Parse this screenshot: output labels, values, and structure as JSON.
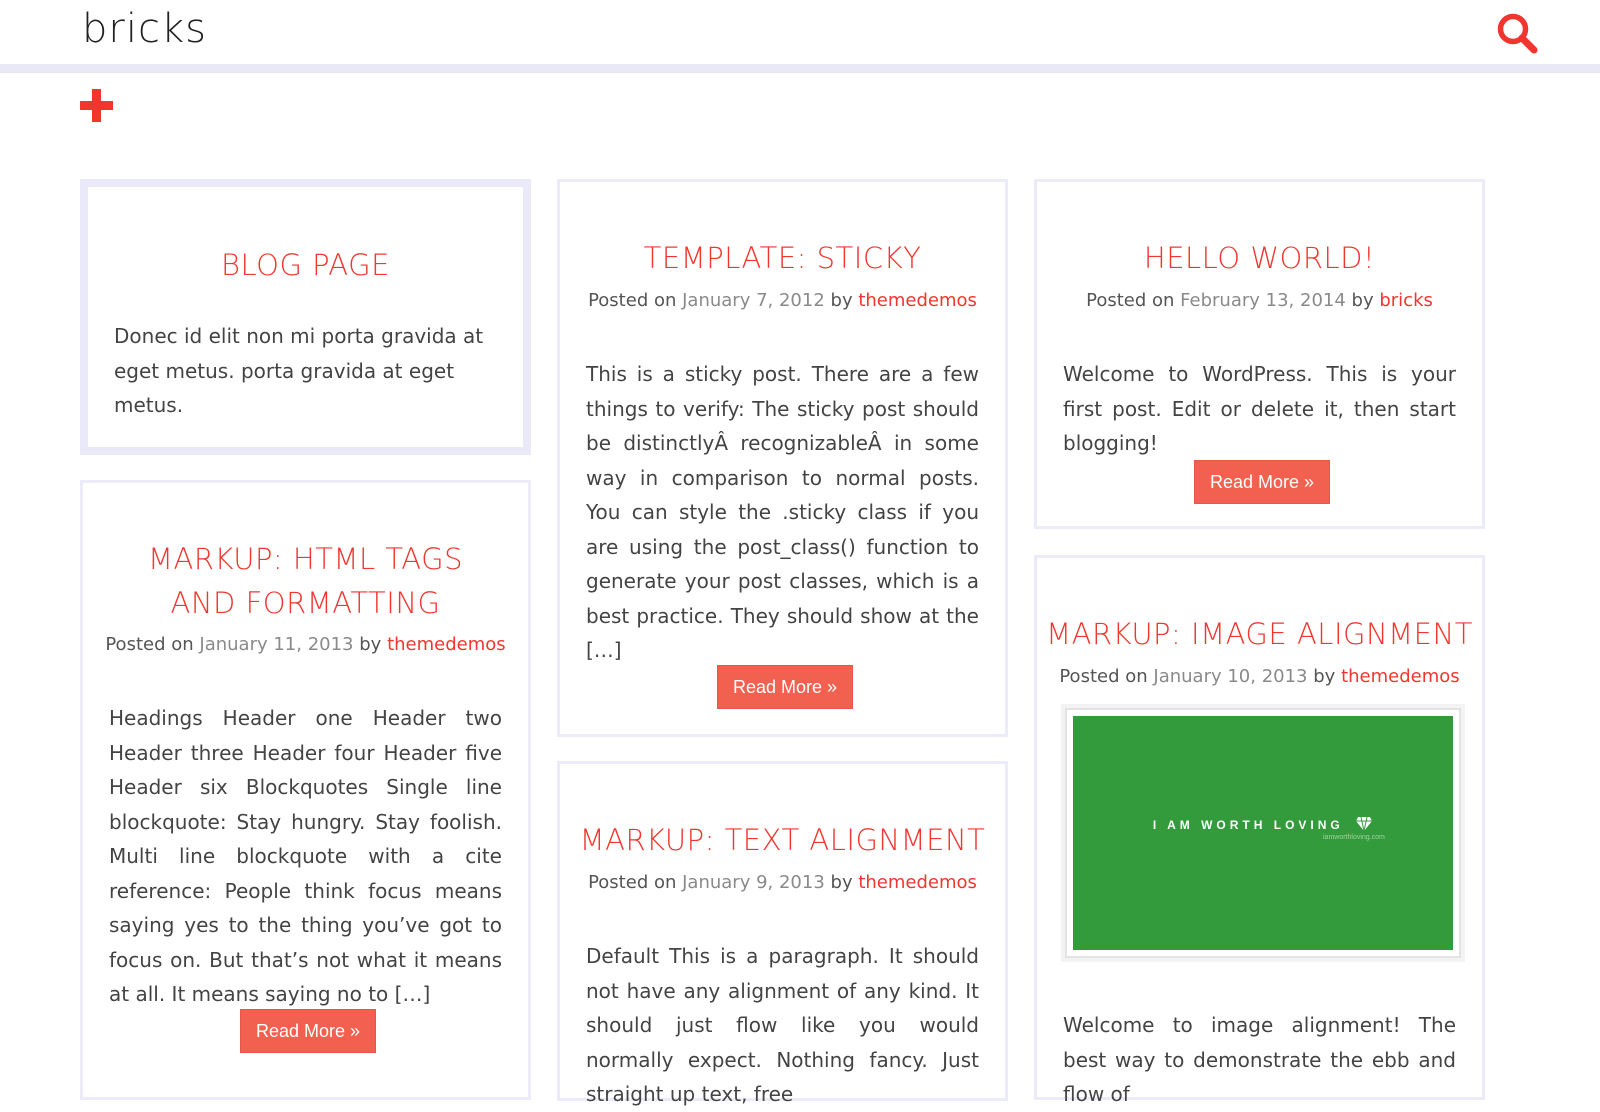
{
  "site": {
    "title": "bricks",
    "accent_color": "#f0362f",
    "button_color": "#f2614f",
    "icons": {
      "search": "search-icon",
      "menu": "plus-icon"
    }
  },
  "posts": [
    {
      "title": "BLOG PAGE",
      "excerpt": "Donec id elit non mi porta gravida at eget metus. porta gravida at eget metus."
    },
    {
      "title": "TEMPLATE: STICKY",
      "meta_prefix": "Posted on",
      "date": "January 7, 2012",
      "meta_by": "by",
      "author": "themedemos",
      "excerpt": "This is a sticky post. There are a few things to verify: The sticky post should be distinctlyÂ recognizableÂ in some way in comparison to normal posts. You can style the .sticky class if you are using the post_class() function to generate your post classes, which is a best practice. They should show at the […]",
      "read_more": "Read More »"
    },
    {
      "title": "HELLO WORLD!",
      "meta_prefix": "Posted on",
      "date": "February 13, 2014",
      "meta_by": "by",
      "author": "bricks",
      "excerpt": "Welcome to WordPress. This is your first post. Edit or delete it, then start blogging!",
      "read_more": "Read More »"
    },
    {
      "title": "MARKUP: HTML TAGS AND FORMATTING",
      "meta_prefix": "Posted on",
      "date": "January 11, 2013",
      "meta_by": "by",
      "author": "themedemos",
      "excerpt": "Headings Header one Header two Header three Header four Header five Header six Blockquotes Single line blockquote: Stay hungry. Stay foolish. Multi line blockquote with a cite reference: People think focus means saying yes to the thing you’ve got to focus on. But that’s not what it means at all. It means saying no to […]",
      "read_more": "Read More »"
    },
    {
      "title": "MARKUP: TEXT ALIGNMENT",
      "meta_prefix": "Posted on",
      "date": "January 9, 2013",
      "meta_by": "by",
      "author": "themedemos",
      "excerpt": "Default This is a paragraph. It should not have any alignment of any kind. It should just flow like you would normally expect. Nothing fancy. Just straight up text, free"
    },
    {
      "title": "MARKUP: IMAGE ALIGNMENT",
      "meta_prefix": "Posted on",
      "date": "January 10, 2013",
      "meta_by": "by",
      "author": "themedemos",
      "image_text": "I AM WORTH LOVING",
      "image_subtext": "iamworthloving.com",
      "image_color": "#339b3c",
      "excerpt": "Welcome to image alignment! The best way to demonstrate the ebb and flow of"
    }
  ]
}
